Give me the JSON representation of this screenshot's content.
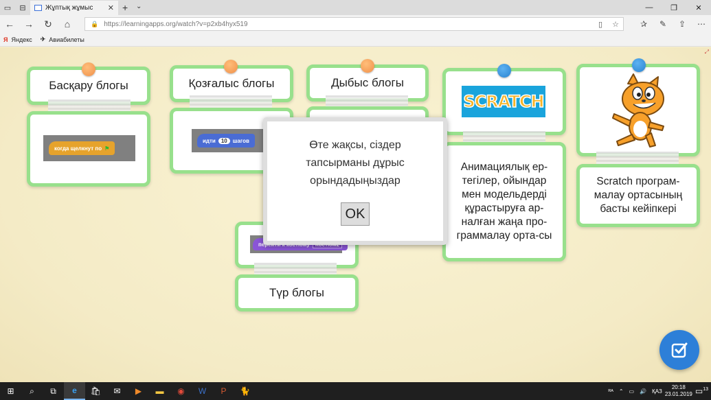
{
  "browser": {
    "tab_title": "Жұптық жұмыс",
    "url": "https://learningapps.org/watch?v=p2xb4hyx519",
    "favorites": [
      {
        "label": "Яндекс",
        "icon": "yandex-icon"
      },
      {
        "label": "Авиабилеты",
        "icon": "plane-icon"
      }
    ]
  },
  "cards": {
    "control": {
      "label": "Басқару блогы"
    },
    "motion": {
      "label": "Қозғалыс блогы"
    },
    "sound": {
      "label": "Дыбыс блогы"
    },
    "looks": {
      "label": "Түр блогы"
    },
    "description": {
      "label": "Анимациялық ер-тегілер, ойындар мен модельдерді құрастыруға ар-налған жаңа про-граммалау орта-сы"
    },
    "character": {
      "label": "Scratch програм-малау ортасының басты кейіпкері"
    }
  },
  "blocks": {
    "when_clicked": "когда щелкнут по",
    "move_steps": "идти",
    "move_value": "10",
    "move_unit": "шагов",
    "switch_costume": "перейти к костюму",
    "costume_value": "Костюм2"
  },
  "logo_text": "SCRATCH",
  "dialog": {
    "message": "Өте жақсы, сіздер тапсырманы дұрыс орындадыңыздар",
    "ok_label": "OK"
  },
  "taskbar": {
    "lang": "ҚАЗ",
    "time": "20:18",
    "date": "23.01.2019",
    "notifications": "13"
  },
  "colors": {
    "card_border": "#98e08c",
    "pin_orange": "#f0904a",
    "pin_blue": "#2a83d0",
    "check_button": "#2d7fd8",
    "control_block": "#e6a32c",
    "motion_block": "#4a6cd4",
    "looks_block": "#8a55d7"
  }
}
